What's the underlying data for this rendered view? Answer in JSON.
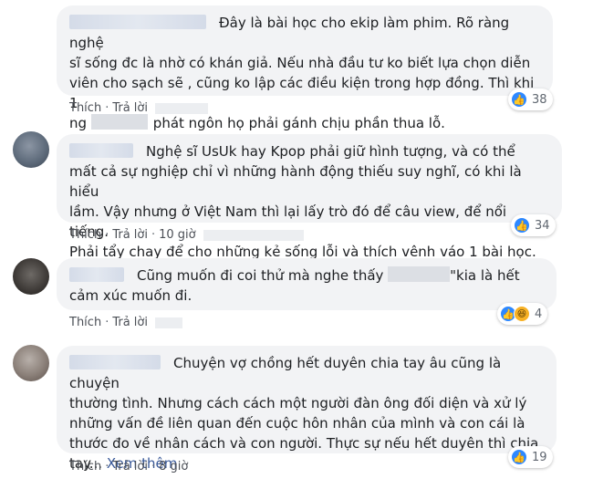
{
  "comments": [
    {
      "lines": [
        "Đây là bài học cho ekip làm phim. Rõ ràng nghệ",
        "sĩ sống đc là nhờ có khán giả. Nếu nhà đầu tư ko biết lựa chọn diễn",
        "viên cho sạch sẽ , cũng ko lập các điều kiện trong hợp đồng. Thì khi 1",
        "ng ",
        "phát ngôn họ phải gánh chịu phần thua lỗ."
      ],
      "reaction_count": "38",
      "like_label": "Thích",
      "reply_label": "Trả lời",
      "time": ""
    },
    {
      "lines": [
        "Nghệ sĩ UsUk hay Kpop phải giữ hình tượng, và có thể",
        "mất cả sự nghiệp chỉ vì những hành động thiếu suy nghĩ, có khi là hiểu",
        "lầm. Vậy nhưng ở Việt Nam thì lại lấy trò đó để câu view, để nổi tiếng.",
        "Phải tẩy chay để cho những kẻ sống lỗi và thích vênh váo 1 bài học."
      ],
      "reaction_count": "34",
      "like_label": "Thích",
      "reply_label": "Trả lời",
      "time": "10 giờ"
    },
    {
      "lines": [
        "Cũng muốn đi coi thử mà nghe thấy ",
        "\"kia là hết",
        "cảm xúc muốn đi."
      ],
      "reaction_count": "4",
      "like_label": "Thích",
      "reply_label": "Trả lời",
      "time": ""
    },
    {
      "lines": [
        "Chuyện vợ chồng hết duyên chia tay âu cũng là chuyện",
        "thường tình. Nhưng cách cách một người đàn ông đối diện và xử lý",
        "những vấn đề liên quan đến cuộc hôn nhân của mình và con cái là",
        "thước đo về nhân cách và con người. Thực sự nếu hết duyên thì chia",
        "tay..."
      ],
      "see_more": "Xem thêm",
      "reaction_count": "19",
      "like_label": "Thích",
      "reply_label": "Trả lời",
      "time": "8 giờ"
    }
  ],
  "icons": {
    "like": "like-icon",
    "haha": "haha-icon"
  },
  "colors": {
    "bubble_bg": "#f2f3f5",
    "like_blue": "#2d88ff",
    "link_blue": "#385898"
  }
}
